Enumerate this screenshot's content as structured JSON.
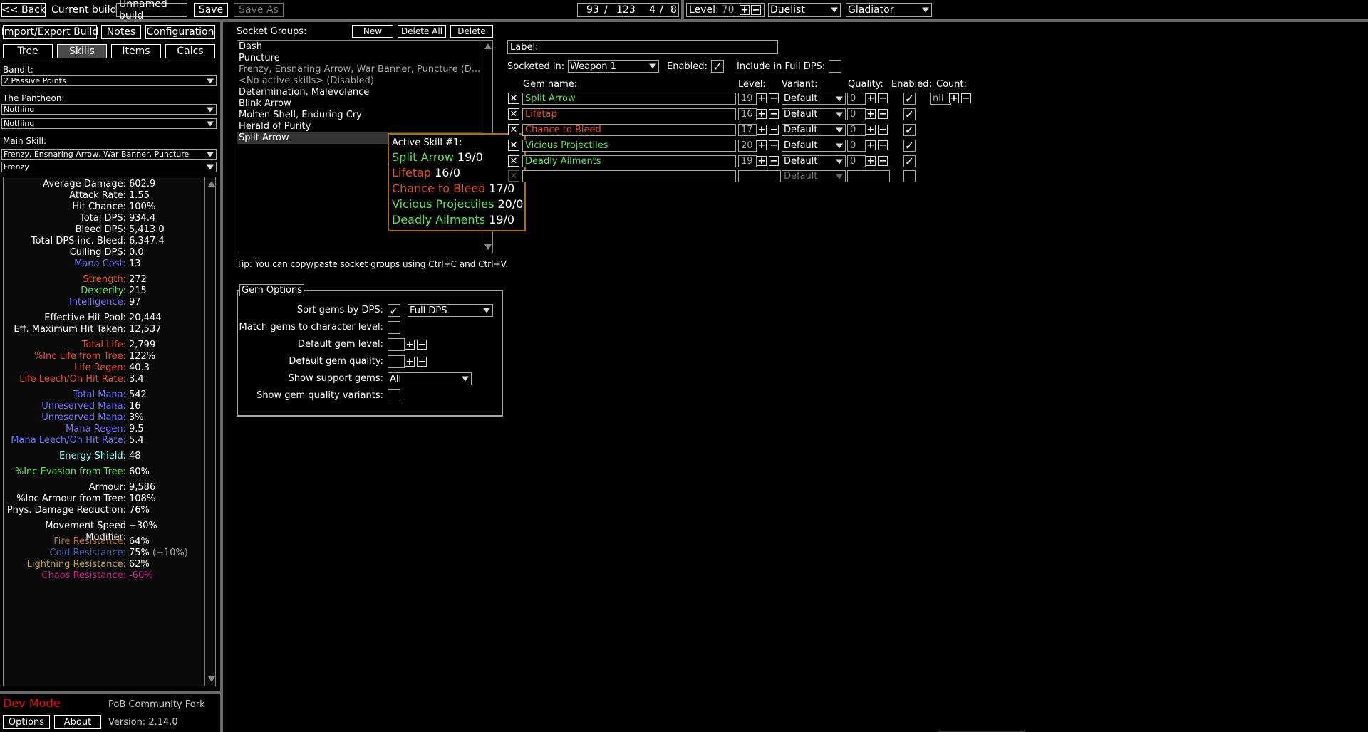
{
  "topbar": {
    "back": "<< Back",
    "current_build_label": "Current build:",
    "build_name": "Unnamed build",
    "save": "Save",
    "save_as": "Save As",
    "points_used": "93",
    "points_sep": "/",
    "points_total": "123",
    "ascend_used": "4",
    "ascend_sep": "/",
    "ascend_total": "8",
    "level_label": "Level:",
    "level_value": "70",
    "class": "Duelist",
    "ascendancy": "Gladiator"
  },
  "left": {
    "import_export": "Import/Export Build",
    "notes": "Notes",
    "configuration": "Configuration",
    "tabs": [
      "Tree",
      "Skills",
      "Items",
      "Calcs"
    ],
    "bandit_label": "Bandit:",
    "bandit_value": "2 Passive Points",
    "pantheon_label": "The Pantheon:",
    "pantheon_major": "Nothing",
    "pantheon_minor": "Nothing",
    "main_skill_label": "Main Skill:",
    "main_skill_value": "Frenzy, Ensnaring Arrow, War Banner, Puncture",
    "main_skill_sub": "Frenzy"
  },
  "stats": [
    {
      "label": "Average Damage:",
      "value": "602.9",
      "cls": "c-white"
    },
    {
      "label": "Attack Rate:",
      "value": "1.55",
      "cls": "c-white"
    },
    {
      "label": "Hit Chance:",
      "value": "100%",
      "cls": "c-white"
    },
    {
      "label": "Total DPS:",
      "value": "934.4",
      "cls": "c-white"
    },
    {
      "label": "Bleed DPS:",
      "value": "5,413.0",
      "cls": "c-white"
    },
    {
      "label": "Total DPS inc. Bleed:",
      "value": "6,347.4",
      "cls": "c-white"
    },
    {
      "label": "Culling DPS:",
      "value": "0.0",
      "cls": "c-white"
    },
    {
      "label": "Mana Cost:",
      "value": "13",
      "cls": "c-mana"
    },
    {
      "gap": true
    },
    {
      "label": "Strength:",
      "value": "272",
      "cls": "c-str"
    },
    {
      "label": "Dexterity:",
      "value": "215",
      "cls": "c-dex"
    },
    {
      "label": "Intelligence:",
      "value": "97",
      "cls": "c-int"
    },
    {
      "gap": true
    },
    {
      "label": "Effective Hit Pool:",
      "value": "20,444",
      "cls": "c-white"
    },
    {
      "label": "Eff. Maximum Hit Taken:",
      "value": "12,537",
      "cls": "c-white"
    },
    {
      "gap": true
    },
    {
      "label": "Total Life:",
      "value": "2,799",
      "cls": "c-life"
    },
    {
      "label": "%Inc Life from Tree:",
      "value": "122%",
      "cls": "c-life"
    },
    {
      "label": "Life Regen:",
      "value": "40.3",
      "cls": "c-life"
    },
    {
      "label": "Life Leech/On Hit Rate:",
      "value": "3.4",
      "cls": "c-life"
    },
    {
      "gap": true
    },
    {
      "label": "Total Mana:",
      "value": "542",
      "cls": "c-mana"
    },
    {
      "label": "Unreserved Mana:",
      "value": "16",
      "cls": "c-mana"
    },
    {
      "label": "Unreserved Mana:",
      "value": "3%",
      "cls": "c-mana"
    },
    {
      "label": "Mana Regen:",
      "value": "9.5",
      "cls": "c-mana"
    },
    {
      "label": "Mana Leech/On Hit Rate:",
      "value": "5.4",
      "cls": "c-mana"
    },
    {
      "gap": true
    },
    {
      "label": "Energy Shield:",
      "value": "48",
      "cls": "c-es"
    },
    {
      "gap": true
    },
    {
      "label": "%Inc Evasion from Tree:",
      "value": "60%",
      "cls": "c-dexg"
    },
    {
      "gap": true
    },
    {
      "label": "Armour:",
      "value": "9,586",
      "cls": "c-white"
    },
    {
      "label": "%Inc Armour from Tree:",
      "value": "108%",
      "cls": "c-white"
    },
    {
      "label": "Phys. Damage Reduction:",
      "value": "76%",
      "cls": "c-white"
    },
    {
      "gap": true
    },
    {
      "label": "Movement Speed Modifier:",
      "value": "+30%",
      "cls": "c-white"
    },
    {
      "gap": true
    },
    {
      "label": "Fire Resistance:",
      "value": "64%",
      "cls": "c-fire"
    },
    {
      "label": "Cold Resistance:",
      "value": "75%",
      "extra": "(+10%)",
      "cls": "c-cold"
    },
    {
      "label": "Lightning Resistance:",
      "value": "62%",
      "cls": "c-light"
    },
    {
      "label": "Chaos Resistance:",
      "value": "-60%",
      "cls": "c-chaos",
      "valcls": "c-chaos"
    }
  ],
  "footer": {
    "dev_mode": "Dev Mode",
    "fork": "PoB Community Fork",
    "options": "Options",
    "about": "About",
    "version": "Version: 2.14.0"
  },
  "socket_groups": {
    "title": "Socket Groups:",
    "new": "New",
    "delete_all": "Delete All",
    "delete": "Delete",
    "items": [
      {
        "text": "Dash",
        "cls": "c-white"
      },
      {
        "text": "Puncture",
        "cls": "c-white"
      },
      {
        "text": "Frenzy, Ensnaring Arrow, War Banner, Puncture (D...",
        "cls": "c-gray"
      },
      {
        "text": "<No active skills> (Disabled)",
        "cls": "c-gray"
      },
      {
        "text": "Determination, Malevolence",
        "cls": "c-white"
      },
      {
        "text": "Blink Arrow",
        "cls": "c-white"
      },
      {
        "text": "Molten Shell, Enduring Cry",
        "cls": "c-white"
      },
      {
        "text": "Herald of Purity",
        "cls": "c-white"
      },
      {
        "text": "Split Arrow",
        "cls": "c-white"
      }
    ],
    "tip": "Tip: You can copy/paste socket groups using Ctrl+C and Ctrl+V."
  },
  "tooltip": {
    "title": "Active Skill #1:",
    "lines": [
      {
        "name": "Split Arrow",
        "val": "19/0",
        "cls": "c-green"
      },
      {
        "name": "Lifetap",
        "val": "16/0",
        "cls": "c-red"
      },
      {
        "name": "Chance to Bleed",
        "val": "17/0",
        "cls": "c-red"
      },
      {
        "name": "Vicious Projectiles",
        "val": "20/0",
        "cls": "c-green"
      },
      {
        "name": "Deadly Ailments",
        "val": "19/0",
        "cls": "c-green"
      }
    ]
  },
  "gem_options": {
    "title": "Gem Options",
    "sort_label": "Sort gems by DPS:",
    "sort_mode": "Full DPS",
    "match_label": "Match gems to character level:",
    "default_level_label": "Default gem level:",
    "default_quality_label": "Default gem quality:",
    "show_support_label": "Show support gems:",
    "show_support_value": "All",
    "show_quality_label": "Show gem quality variants:"
  },
  "socket_edit": {
    "label_label": "Label:",
    "socketed_in_label": "Socketed in:",
    "socketed_in_value": "Weapon 1",
    "enabled_label": "Enabled:",
    "full_dps_label": "Include in Full DPS:",
    "col_gem_name": "Gem name:",
    "col_level": "Level:",
    "col_variant": "Variant:",
    "col_quality": "Quality:",
    "col_enabled": "Enabled:",
    "col_count": "Count:",
    "count_value": "nil",
    "gems": [
      {
        "name": "Split Arrow",
        "level": "19",
        "variant": "Default",
        "quality": "0",
        "cls": "c-green"
      },
      {
        "name": "Lifetap",
        "level": "16",
        "variant": "Default",
        "quality": "0",
        "cls": "c-red"
      },
      {
        "name": "Chance to Bleed",
        "level": "17",
        "variant": "Default",
        "quality": "0",
        "cls": "c-red"
      },
      {
        "name": "Vicious Projectiles",
        "level": "20",
        "variant": "Default",
        "quality": "0",
        "cls": "c-green"
      },
      {
        "name": "Deadly Ailments",
        "level": "19",
        "variant": "Default",
        "quality": "0",
        "cls": "c-green"
      }
    ],
    "empty_variant": "Default"
  }
}
